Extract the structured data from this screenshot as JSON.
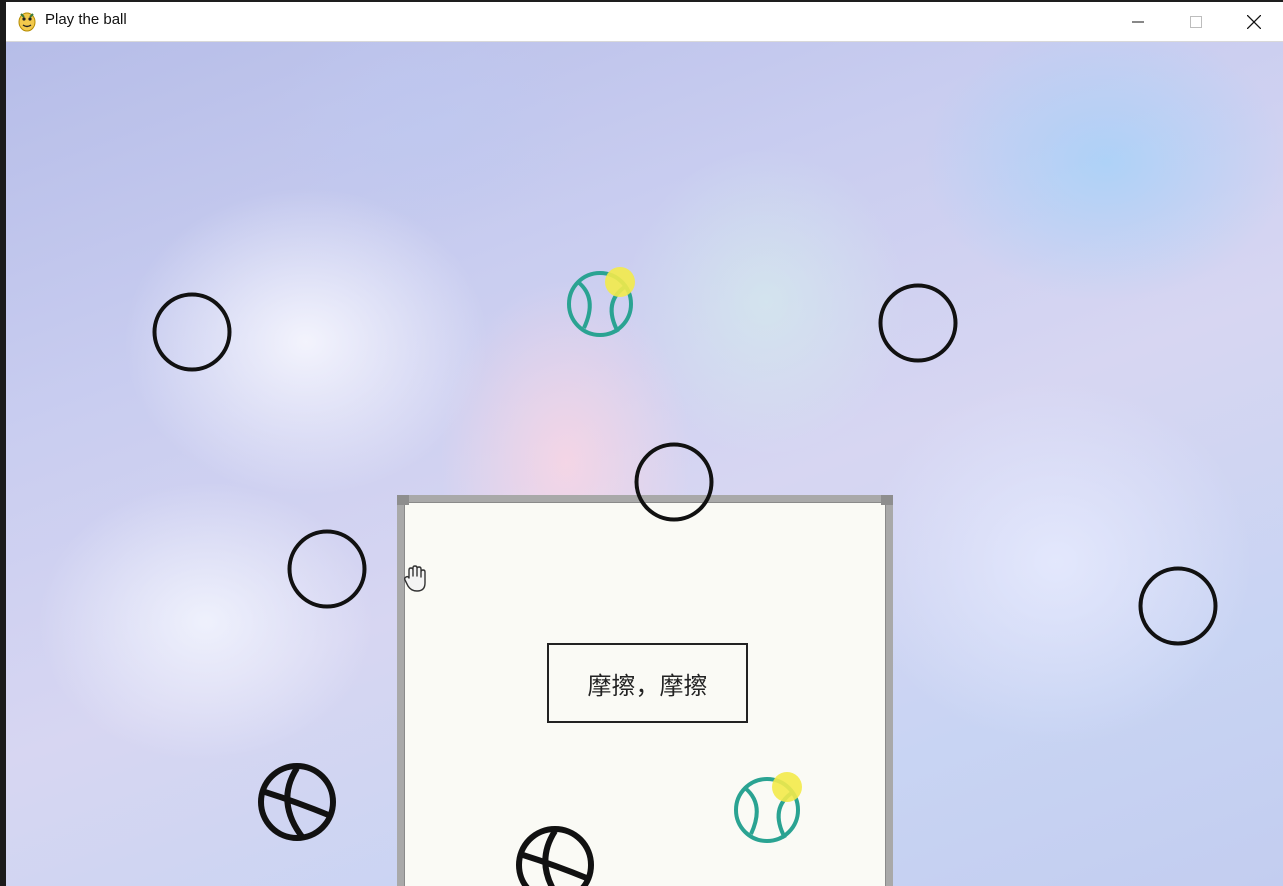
{
  "window": {
    "title": "Play the ball",
    "app_icon": "python-snake-icon",
    "controls": [
      "minimize-icon",
      "maximize-icon",
      "close-icon"
    ]
  },
  "board": {
    "label": "摩擦，摩擦"
  },
  "cursor": {
    "icon": "hand-grab-icon"
  },
  "colors": {
    "ring": "#111111",
    "ball_teal": "#2aa392",
    "ball_highlight": "#f3ea4a",
    "board_fill": "#fafaf5",
    "board_frame": "#a9a9a9"
  }
}
